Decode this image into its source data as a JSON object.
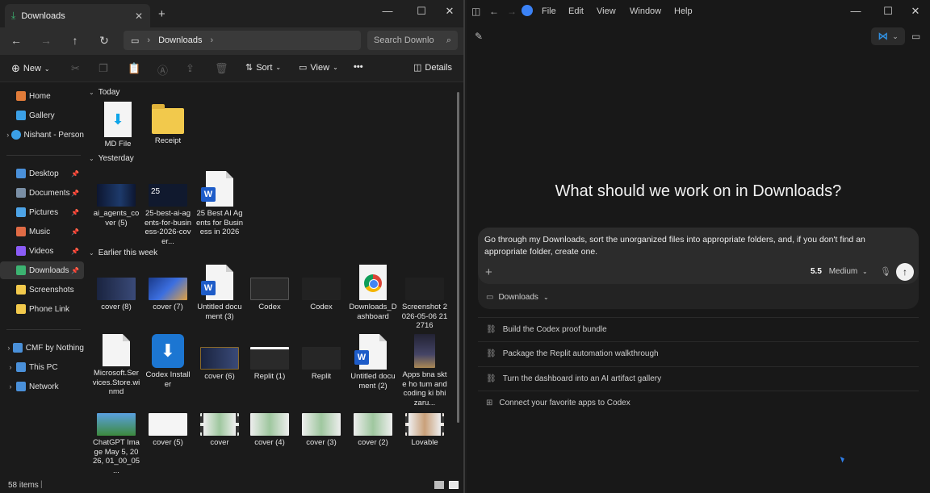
{
  "explorer": {
    "tab_title": "Downloads",
    "address": "Downloads",
    "search_placeholder": "Search Downlo",
    "toolbar": {
      "new": "New",
      "sort": "Sort",
      "view": "View",
      "more": "•••",
      "details": "Details"
    },
    "sidebar": [
      {
        "label": "Home",
        "icon": "home-icon",
        "color": "#e07b39"
      },
      {
        "label": "Gallery",
        "icon": "gallery-icon",
        "color": "#3ba0e6"
      },
      {
        "label": "Nishant - Person",
        "icon": "cloud-icon",
        "color": "#3ba0e6"
      },
      {
        "label": "Desktop",
        "icon": "desktop-icon",
        "color": "#4a90d9"
      },
      {
        "label": "Documents",
        "icon": "documents-icon",
        "color": "#7a8fa6"
      },
      {
        "label": "Pictures",
        "icon": "pictures-icon",
        "color": "#4da3e6"
      },
      {
        "label": "Music",
        "icon": "music-icon",
        "color": "#e06b45"
      },
      {
        "label": "Videos",
        "icon": "videos-icon",
        "color": "#8b5cf6"
      },
      {
        "label": "Downloads",
        "icon": "downloads-icon",
        "color": "#3cb371"
      },
      {
        "label": "Screenshots",
        "icon": "folder-icon",
        "color": "#f2c94c"
      },
      {
        "label": "Phone Link",
        "icon": "folder-icon",
        "color": "#f2c94c"
      },
      {
        "label": "CMF by Nothing",
        "icon": "device-icon",
        "color": "#4a90d9"
      },
      {
        "label": "This PC",
        "icon": "pc-icon",
        "color": "#4a90d9"
      },
      {
        "label": "Network",
        "icon": "network-icon",
        "color": "#4a90d9"
      }
    ],
    "groups": {
      "today": "Today",
      "yesterday": "Yesterday",
      "earlier": "Earlier this week"
    },
    "files": {
      "today": [
        "MD File",
        "Receipt"
      ],
      "yesterday": [
        "ai_agents_cover (5)",
        "25-best-ai-agents-for-business-2026-cover...",
        "25 Best AI Agents for Business in 2026"
      ],
      "earlier_row1": [
        "cover (8)",
        "cover (7)",
        "Untitled document (3)",
        "Codex",
        "Codex",
        "Downloads_Dashboard",
        "Screenshot 2026-05-06 212716"
      ],
      "earlier_row2": [
        "Microsoft.Services.Store.winmd",
        "Codex Installer",
        "cover (6)",
        "Replit (1)",
        "Replit",
        "Untitled document (2)",
        "Apps bna skte ho tum and coding ki bhi zaru..."
      ],
      "earlier_row3": [
        "ChatGPT Image May 5, 2026, 01_00_05 ...",
        "cover (5)",
        "cover",
        "cover (4)",
        "cover (3)",
        "cover (2)",
        "Lovable"
      ]
    },
    "thumb_text": "25",
    "status": "58 items"
  },
  "codex": {
    "menu": [
      "File",
      "Edit",
      "View",
      "Window",
      "Help"
    ],
    "heading": "What should we work on in Downloads?",
    "prompt": "Go through my Downloads, sort the unorganized files into appropriate folders, and, if you don't find an appropriate folder, create one.",
    "model_version": "5.5",
    "model_effort": "Medium",
    "folder": "Downloads",
    "suggestions": [
      "Build the Codex proof bundle",
      "Package the Replit automation walkthrough",
      "Turn the dashboard into an AI artifact gallery",
      "Connect your favorite apps to Codex"
    ]
  }
}
